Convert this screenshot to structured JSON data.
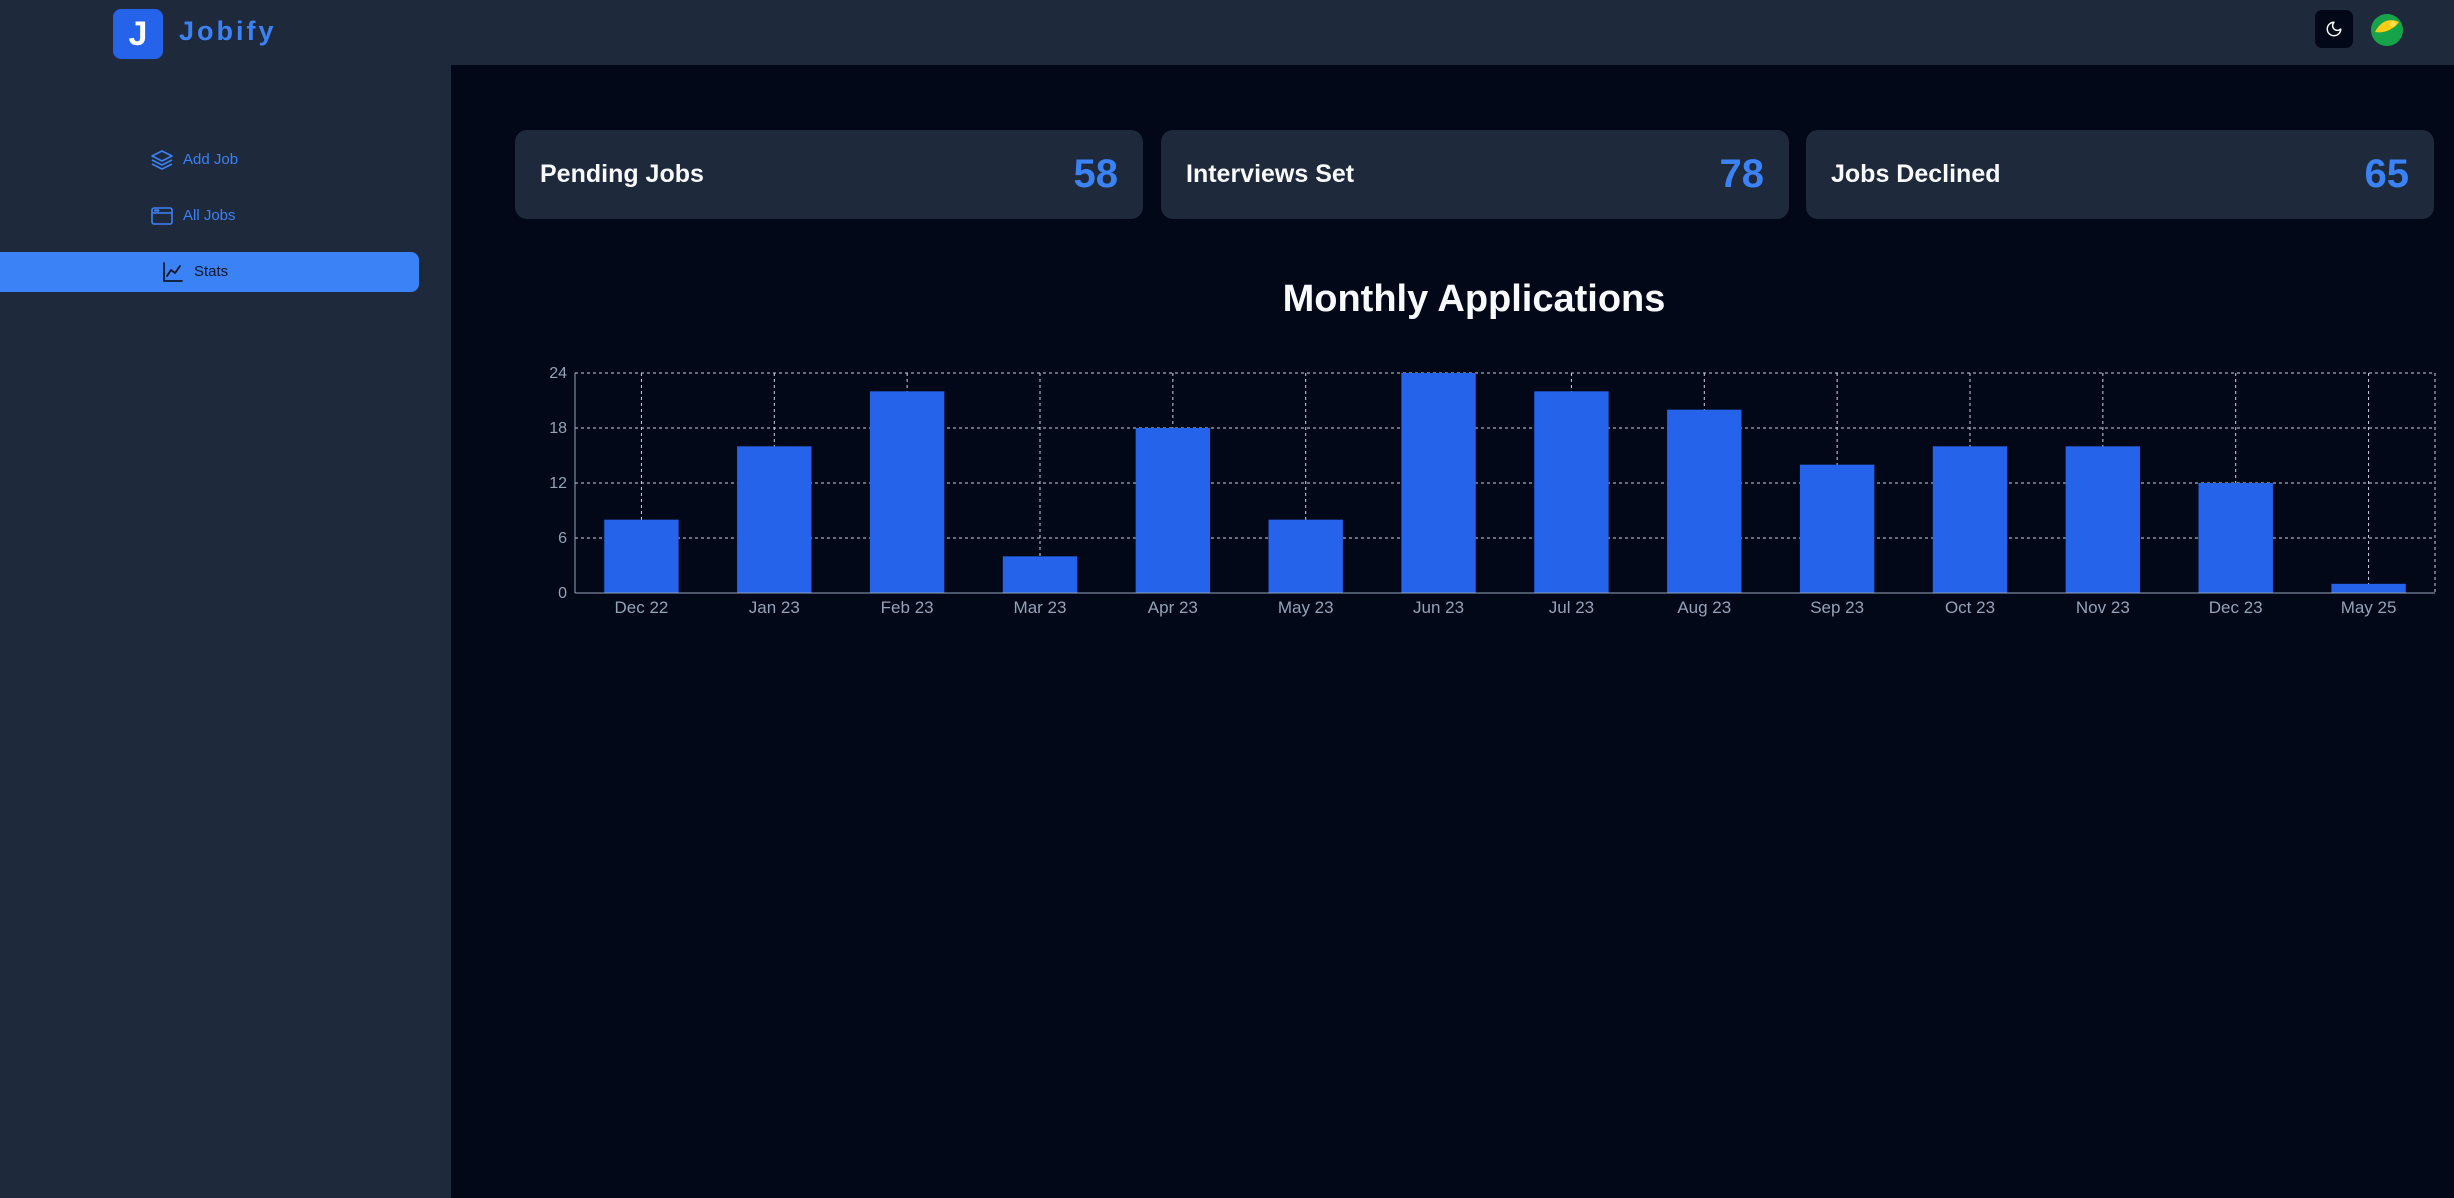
{
  "header": {
    "logo_letter": "J",
    "brand": "Jobify",
    "theme_icon": "moon-icon",
    "avatar_icon": "user-avatar"
  },
  "sidebar": {
    "items": [
      {
        "label": "Add Job",
        "icon": "layers-icon",
        "active": false
      },
      {
        "label": "All Jobs",
        "icon": "browser-window-icon",
        "active": false
      },
      {
        "label": "Stats",
        "icon": "area-chart-icon",
        "active": true
      }
    ]
  },
  "stats": [
    {
      "title": "Pending Jobs",
      "value": "58"
    },
    {
      "title": "Interviews Set",
      "value": "78"
    },
    {
      "title": "Jobs Declined",
      "value": "65"
    }
  ],
  "colors": {
    "accent": "#3b82f6",
    "bar": "#2563eb",
    "background": "#020817",
    "panel": "#1e293b"
  },
  "chart_data": {
    "type": "bar",
    "title": "Monthly Applications",
    "categories": [
      "Dec 22",
      "Jan 23",
      "Feb 23",
      "Mar 23",
      "Apr 23",
      "May 23",
      "Jun 23",
      "Jul 23",
      "Aug 23",
      "Sep 23",
      "Oct 23",
      "Nov 23",
      "Dec 23",
      "May 25"
    ],
    "values": [
      8,
      16,
      22,
      4,
      18,
      8,
      24,
      22,
      20,
      14,
      16,
      16,
      12,
      1
    ],
    "ylim": [
      0,
      24
    ],
    "yticks": [
      0,
      6,
      12,
      18,
      24
    ],
    "grid": true,
    "legend": "none"
  }
}
